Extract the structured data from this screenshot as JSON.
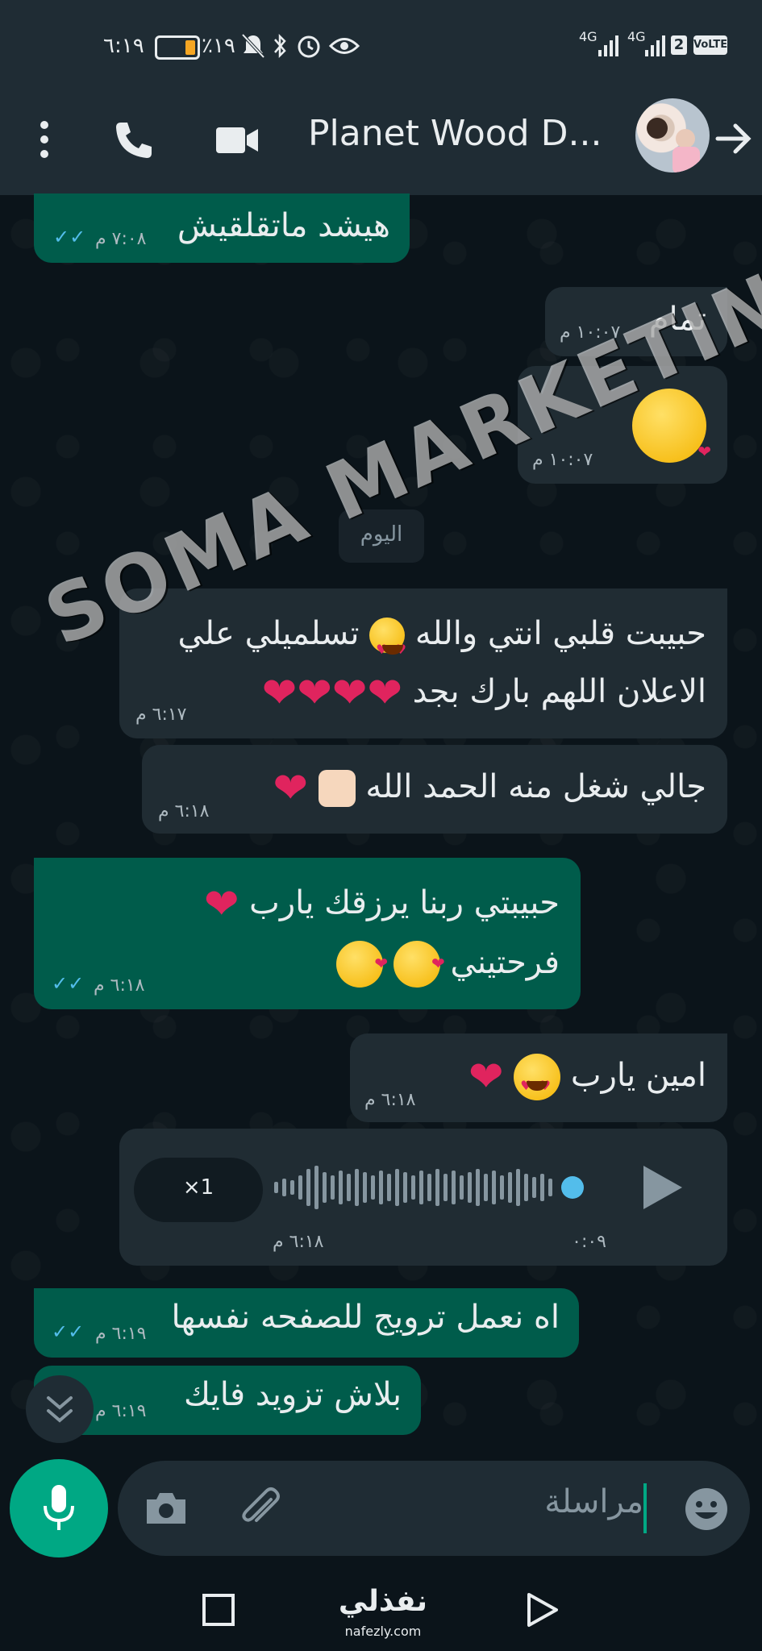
{
  "status_bar": {
    "time": "٦:١٩",
    "battery_percent": "٪١٩",
    "network_1": "4G",
    "network_2": "4G",
    "sim_badge": "2",
    "volte": "VoLTE"
  },
  "header": {
    "contact_name": "Planet Wood D...",
    "icons": [
      "more-vert-icon",
      "call-icon",
      "video-call-icon",
      "back-arrow-icon"
    ]
  },
  "messages": {
    "m1": {
      "text": "هيشد ماتقلقيش",
      "time": "٧:٠٨ م",
      "direction": "outgoing",
      "read": true
    },
    "m2": {
      "text": "تمام",
      "time": "١٠:٠٧ م",
      "direction": "incoming"
    },
    "m3": {
      "emoji": "kissing-face",
      "time": "١٠:٠٧ م",
      "direction": "incoming"
    },
    "m4": {
      "line1": "حبيبت قلبي انتي والله",
      "line1_end": "تسلميلي علي",
      "line2": "الاعلان اللهم بارك بجد",
      "time": "٦:١٧ م",
      "direction": "incoming"
    },
    "m5": {
      "text": "جالي شغل منه الحمد الله",
      "time": "٦:١٨ م",
      "direction": "incoming"
    },
    "m6": {
      "line1": "حبيبتي ربنا يرزقك يارب",
      "line2": "فرحتيني",
      "time": "٦:١٨ م",
      "direction": "outgoing",
      "read": true
    },
    "m7": {
      "text": "امين يارب",
      "time": "٦:١٨ م",
      "direction": "incoming"
    },
    "m8": {
      "speed": "×1",
      "duration": "٠:٠٩",
      "time": "٦:١٨ م",
      "direction": "incoming",
      "type": "voice"
    },
    "m9": {
      "text": "اه نعمل ترويج للصفحه نفسها",
      "time": "٦:١٩ م",
      "direction": "outgoing",
      "read": true
    },
    "m10": {
      "text": "بلاش تزويد فايك",
      "time": "٦:١٩ م",
      "direction": "outgoing",
      "read": true
    }
  },
  "date_divider": "اليوم",
  "watermark": "SOMA MARKETING",
  "composer": {
    "placeholder": "مراسلة"
  },
  "branding": {
    "logo_text": "نفذلي",
    "url": "nafezly.com"
  },
  "colors": {
    "outgoing": "#005c4b",
    "incoming": "#202c33",
    "accent": "#00a884",
    "read_ticks": "#53bdeb"
  }
}
